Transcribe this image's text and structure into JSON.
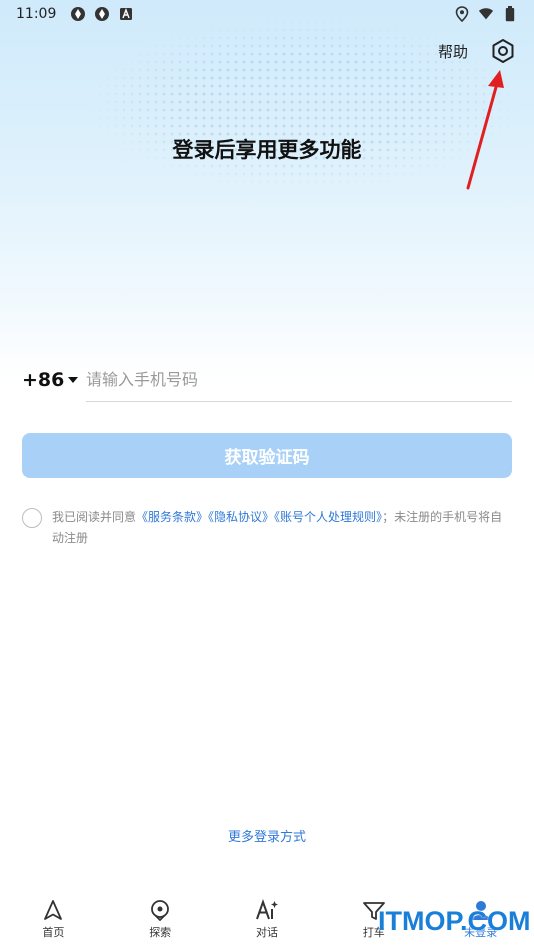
{
  "status_bar": {
    "time": "11:09",
    "left_icons": [
      "app-icon",
      "app-icon",
      "a-icon"
    ],
    "right_icons": [
      "location-icon",
      "wifi-icon",
      "battery-icon"
    ]
  },
  "header": {
    "help_label": "帮助",
    "settings_icon": "settings-icon"
  },
  "headline": "登录后享用更多功能",
  "login": {
    "country_code": "+86",
    "phone_placeholder": "请输入手机号码",
    "phone_value": "",
    "get_code_label": "获取验证码"
  },
  "agreement": {
    "prefix": "我已阅读并同意",
    "terms_link": "《服务条款》",
    "privacy_link": "《隐私协议》",
    "personal_link": "《账号个人处理规则》",
    "suffix": "；未注册的手机号将自动注册"
  },
  "more_login": "更多登录方式",
  "bottom_nav": {
    "items": [
      {
        "label": "首页",
        "icon": "navigation-icon"
      },
      {
        "label": "探索",
        "icon": "location-pin-icon"
      },
      {
        "label": "对话",
        "icon": "ai-icon"
      },
      {
        "label": "打车",
        "icon": "taxi-icon"
      },
      {
        "label": "未登录",
        "icon": "user-icon"
      }
    ]
  },
  "watermark": "ITMOP.COM",
  "colors": {
    "accent": "#2f79d8",
    "button_disabled": "#a9d1f8",
    "annotation_arrow": "#e02020"
  }
}
